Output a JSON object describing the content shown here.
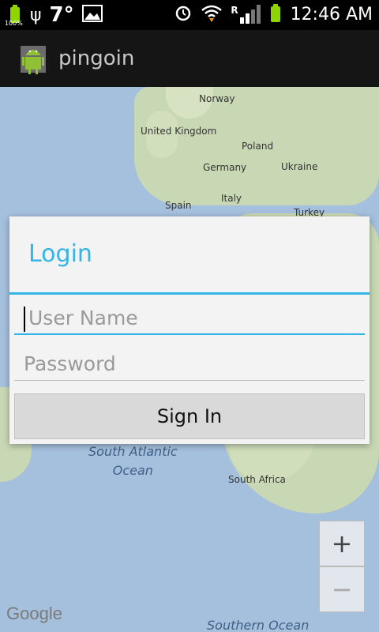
{
  "status_bar": {
    "battery_percent": "100%",
    "temperature": "7°",
    "time": "12:46 AM",
    "network": "R"
  },
  "action_bar": {
    "app_title": "pingoin",
    "icon": "android-icon"
  },
  "map": {
    "labels": {
      "norway": "Norway",
      "uk": "United Kingdom",
      "poland": "Poland",
      "germany": "Germany",
      "ukraine": "Ukraine",
      "italy": "Italy",
      "spain": "Spain",
      "turkey": "Turkey",
      "south_africa": "South Africa"
    },
    "ocean_labels": {
      "south_atlantic": "South Atlantic\nOcean",
      "southern": "Southern Ocean"
    },
    "zoom_in": "+",
    "zoom_out": "−",
    "attribution": "Google"
  },
  "login_dialog": {
    "title": "Login",
    "username_placeholder": "User Name",
    "password_placeholder": "Password",
    "signin_label": "Sign In"
  },
  "colors": {
    "accent": "#33b5e5",
    "action_bar_bg": "#151515",
    "battery_green": "#8fd400"
  }
}
